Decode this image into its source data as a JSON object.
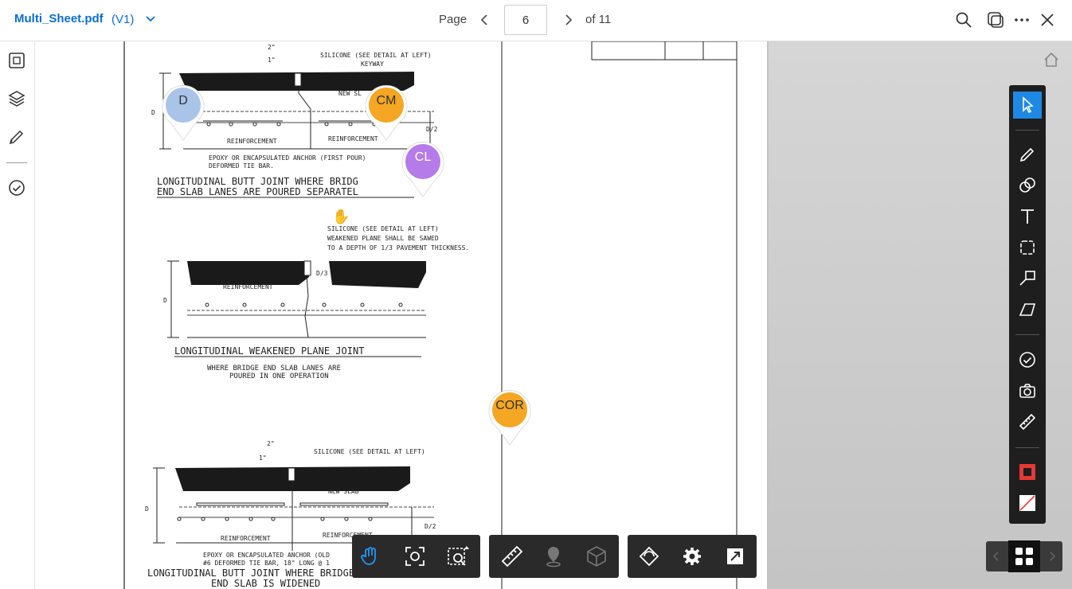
{
  "header": {
    "file_name": "Multi_Sheet.pdf",
    "version": "(V1)",
    "page_label": "Page",
    "page_value": "6",
    "of_label": "of 11"
  },
  "icons": {
    "version_dropdown": "chevron-down-icon",
    "prev": "chevron-left-icon",
    "next": "chevron-right-icon",
    "search": "search-icon",
    "compare": "compare-icon",
    "more": "more-icon",
    "close": "close-icon"
  },
  "sidebar": {
    "items": [
      {
        "name": "sheets-icon"
      },
      {
        "name": "layers-icon"
      },
      {
        "name": "markup-pen-icon"
      },
      {
        "name": "issues-check-icon"
      }
    ]
  },
  "pins": [
    {
      "label": "D",
      "color": "#a9c4e8"
    },
    {
      "label": "CM",
      "color": "#f5a623"
    },
    {
      "label": "CL",
      "color": "#b57be8"
    },
    {
      "label": "COR",
      "color": "#f5a623"
    }
  ],
  "drawing": {
    "detail1": {
      "dim_2in": "2\"",
      "dim_1in": "1\"",
      "silicone": "SILICONE (SEE DETAIL AT LEFT)",
      "keyway": "KEYWAY",
      "new_slab": "NEW SL",
      "reinforcement_a": "REINFORCEMENT",
      "reinforcement_b": "REINFORCEMENT",
      "epoxy_1": "EPOXY OR ENCAPSULATED ANCHOR (FIRST POUR)",
      "epoxy_2": "DEFORMED TIE BAR.",
      "d": "D",
      "d2": "D/2",
      "title_1": "LONGITUDINAL BUTT JOINT WHERE BRIDG",
      "title_2": "END SLAB LANES ARE POURED SEPARATEL"
    },
    "detail2": {
      "silicone": "SILICONE (SEE DETAIL AT LEFT)",
      "weakened_1": "WEAKENED PLANE SHALL BE SAWED",
      "weakened_2": "TO A DEPTH OF 1/3 PAVEMENT THICKNESS.",
      "reinforcement": "REINFORCEMENT",
      "d": "D",
      "d3": "D/3",
      "title": "LONGITUDINAL WEAKENED PLANE JOINT",
      "sub_1": "WHERE BRIDGE END SLAB LANES ARE",
      "sub_2": "POURED IN ONE OPERATION"
    },
    "detail3": {
      "dim_2in": "2\"",
      "dim_1in": "1\"",
      "silicone": "SILICONE (SEE DETAIL AT LEFT)",
      "new_slab": "NEW SLAB",
      "reinforcement_a": "REINFORCEMENT",
      "reinforcement_b": "REINFORCEMENT",
      "epoxy_1": "EPOXY OR ENCAPSULATED ANCHOR (OLD",
      "epoxy_2": "#6 DEFORMED TIE BAR, 18\" LONG @ 1",
      "d": "D",
      "d2": "D/2",
      "title_1": "LONGITUDINAL BUTT JOINT WHERE BRIDGE",
      "title_2": "END SLAB IS WIDENED"
    }
  },
  "right_toolbar": {
    "tools": [
      "select-cursor-icon",
      "freehand-pen-icon",
      "shapes-icon",
      "text-icon",
      "cloud-icon",
      "callout-arrow-icon",
      "polyline-icon",
      "check-stamp-icon",
      "camera-icon",
      "measure-ruler-icon",
      "stroke-color-icon",
      "fill-none-icon"
    ],
    "active_color": "#1e88e5",
    "stroke_color": "#e53935"
  },
  "bottom_toolbar": {
    "group1": [
      "pan-hand-icon",
      "fit-to-view-icon",
      "zoom-window-icon"
    ],
    "group2": [
      "measure-icon",
      "location-pin-icon",
      "3d-cube-icon"
    ],
    "group3": [
      "rotate-icon",
      "settings-icon",
      "fullscreen-icon"
    ]
  }
}
